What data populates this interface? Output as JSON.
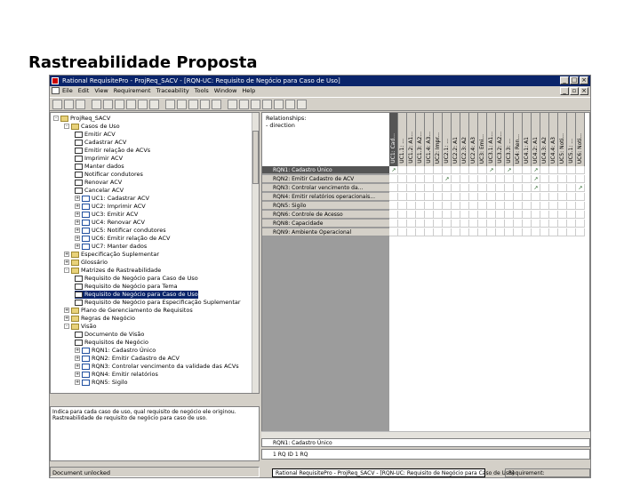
{
  "slide": {
    "title": "Rastreabilidade Proposta"
  },
  "window": {
    "title": "Rational RequisitePro - ProjReq_SACV - [RQN-UC: Requisito de Negócio para Caso de Uso]",
    "menu": [
      "Eile",
      "Edit",
      "View",
      "Requirement",
      "Traceability",
      "Tools",
      "Window",
      "Help"
    ]
  },
  "tree": {
    "nodes": [
      {
        "text": "ProjReq_SACV",
        "type": "fold",
        "exp": "-"
      },
      {
        "text": "Casos de Uso",
        "type": "fold",
        "exp": "-"
      },
      {
        "text": "Emitir ACV",
        "type": "doc",
        "exp": ""
      },
      {
        "text": "Cadastrar ACV",
        "type": "doc",
        "exp": ""
      },
      {
        "text": "Emitir relação de ACVs",
        "type": "doc",
        "exp": ""
      },
      {
        "text": "Imprimir ACV",
        "type": "doc",
        "exp": ""
      },
      {
        "text": "Manter dados",
        "type": "doc",
        "exp": ""
      },
      {
        "text": "Notificar condutores",
        "type": "doc",
        "exp": ""
      },
      {
        "text": "Renovar ACV",
        "type": "doc",
        "exp": ""
      },
      {
        "text": "Cancelar ACV",
        "type": "doc",
        "exp": ""
      },
      {
        "text": "UC1: Cadastrar ACV",
        "type": "uc",
        "exp": "+"
      },
      {
        "text": "UC2: Imprimir ACV",
        "type": "uc",
        "exp": "+"
      },
      {
        "text": "UC3: Emitir ACV",
        "type": "uc",
        "exp": "+"
      },
      {
        "text": "UC4: Renovar ACV",
        "type": "uc",
        "exp": "+"
      },
      {
        "text": "UC5: Notificar condutores",
        "type": "uc",
        "exp": "+"
      },
      {
        "text": "UC6: Emitir relação de ACV",
        "type": "uc",
        "exp": "+"
      },
      {
        "text": "UC7: Manter dados",
        "type": "uc",
        "exp": "+"
      },
      {
        "text": "Especificação Suplementar",
        "type": "fold",
        "exp": "+"
      },
      {
        "text": "Glossário",
        "type": "fold",
        "exp": "+"
      },
      {
        "text": "Matrizes de Rastreabilidade",
        "type": "fold",
        "exp": "-"
      },
      {
        "text": "Requisito de Negócio para Caso de Uso",
        "type": "doc",
        "exp": ""
      },
      {
        "text": "Requisito de Negócio para Tema",
        "type": "doc",
        "exp": ""
      },
      {
        "text": "Requisito de Negócio para Caso de Uso",
        "type": "doc",
        "exp": "",
        "selected": true
      },
      {
        "text": "Requisito de Negócio para Especificação Suplementar",
        "type": "doc",
        "exp": ""
      },
      {
        "text": "Plano de Gerenciamento de Requisitos",
        "type": "fold",
        "exp": "+"
      },
      {
        "text": "Regras de Negócio",
        "type": "fold",
        "exp": "+"
      },
      {
        "text": "Visão",
        "type": "fold",
        "exp": "-"
      },
      {
        "text": "Documento de Visão",
        "type": "doc",
        "exp": ""
      },
      {
        "text": "Requisitos de Negócio",
        "type": "doc",
        "exp": ""
      },
      {
        "text": "RQN1: Cadastro Único",
        "type": "uc",
        "exp": "+"
      },
      {
        "text": "RQN2: Emitir Cadastro de ACV",
        "type": "uc",
        "exp": "+"
      },
      {
        "text": "RQN3: Controlar vencimento da validade das ACVs",
        "type": "uc",
        "exp": "+"
      },
      {
        "text": "RQN4: Emitir relatórios",
        "type": "uc",
        "exp": "+"
      },
      {
        "text": "RQN5: Sigilo",
        "type": "uc",
        "exp": "+"
      }
    ]
  },
  "description": "Indica para cada caso de uso, qual requisito de negócio ele originou. Rastreabilidade de requisito de negócio para caso de uso.",
  "status_left": "Document unlocked",
  "matrix": {
    "header": [
      "Relationships:",
      "- direction"
    ],
    "columns": [
      "UC1: Cad...",
      "UC1.1: ...",
      "UC1.2: A1...",
      "UC1.3: A2...",
      "UC1.4: A3...",
      "UC2: Impr...",
      "UC2.1: ...",
      "UC2.2: A1",
      "UC2.3: A2",
      "UC2.4: A3",
      "UC3: Emi...",
      "UC3.1: A1...",
      "UC3.2: A2...",
      "UC3.3: ...",
      "UC4: Ren...",
      "UC4.1: A1",
      "UC4.2: A1",
      "UC4.3: A2",
      "UC4.4: A3",
      "UC5: Noti...",
      "UC5.1: ...",
      "UC6: Noti..."
    ],
    "rows": [
      "RQN1: Cadastro Único",
      "RQN2: Emitir Cadastro de ACV",
      "RQN3: Controlar vencimento da...",
      "RQN4: Emitir relatórios operacionais...",
      "RQN5: Sigilo",
      "RQN6: Controle de Acesso",
      "RQN8: Capacidade",
      "RQN9: Ambiente Operacional"
    ],
    "marks": [
      [
        0,
        0
      ],
      [
        0,
        11
      ],
      [
        0,
        16
      ],
      [
        1,
        6
      ],
      [
        1,
        16
      ],
      [
        2,
        16
      ],
      [
        2,
        21
      ],
      [
        0,
        13
      ]
    ]
  },
  "bottom_row": "RQN1: Cadastro Único",
  "bottom_row2": "1 RQ ID 1 RQ",
  "taskbar": "Rational RequisitePro - ProjReq_SACV - [RQN-UC: Requisito de Negócio para Caso de Uso]",
  "status_right": "Requirement:"
}
